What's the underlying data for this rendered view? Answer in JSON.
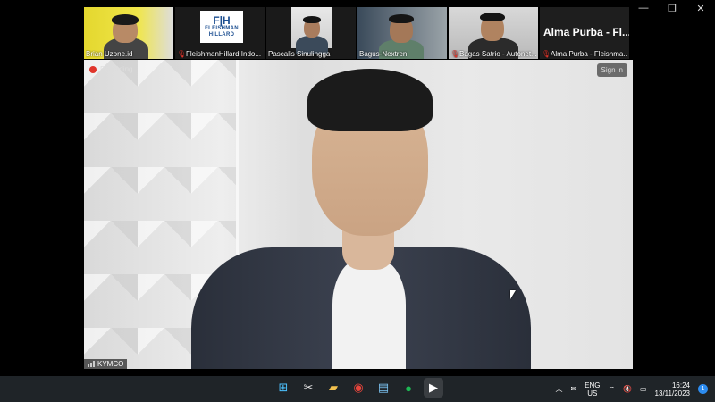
{
  "window_controls": {
    "minimize": "—",
    "restore": "❐",
    "close": "✕"
  },
  "thumbnails": [
    {
      "name": "Brian Uzone.id",
      "muted": false
    },
    {
      "name": "FleishmanHillard Indo...",
      "muted": true,
      "logo": {
        "mark": "F|H",
        "line1": "FLEISHMAN",
        "line2": "HILLARD"
      }
    },
    {
      "name": "Pascalis Sinulingga",
      "muted": false
    },
    {
      "name": "Bagus-Nextren",
      "muted": false
    },
    {
      "name": "Bagas Satrio - Autonet...",
      "muted": true
    },
    {
      "name": "Alma Purba - Fleishma...",
      "muted": true,
      "big_name": "Alma Purba - Fl..."
    }
  ],
  "main_video": {
    "recording_label": "Recording",
    "sign_in_label": "Sign in",
    "speaker_name": "KYMCO"
  },
  "taskbar": {
    "apps": [
      {
        "icon": "windows-start-icon",
        "glyph": "⊞",
        "color": "#4cc2ff"
      },
      {
        "icon": "snipping-tool-icon",
        "glyph": "✂",
        "color": "#e8e8e8"
      },
      {
        "icon": "file-explorer-icon",
        "glyph": "▰",
        "color": "#f2c14e"
      },
      {
        "icon": "chrome-icon",
        "glyph": "◉",
        "color": "#e8453c"
      },
      {
        "icon": "notepad-icon",
        "glyph": "▤",
        "color": "#7fc8f8"
      },
      {
        "icon": "spotify-icon",
        "glyph": "●",
        "color": "#1db954"
      },
      {
        "icon": "media-player-icon",
        "glyph": "▶",
        "color": "#ffffff"
      }
    ],
    "tray": {
      "chevron": "︿",
      "wechat": "✉",
      "lang_top": "ENG",
      "lang_bottom": "US",
      "wifi": "⌔",
      "volume": "🔇",
      "battery": "▭",
      "time": "16:24",
      "date": "13/11/2023",
      "notifications": "1"
    }
  }
}
